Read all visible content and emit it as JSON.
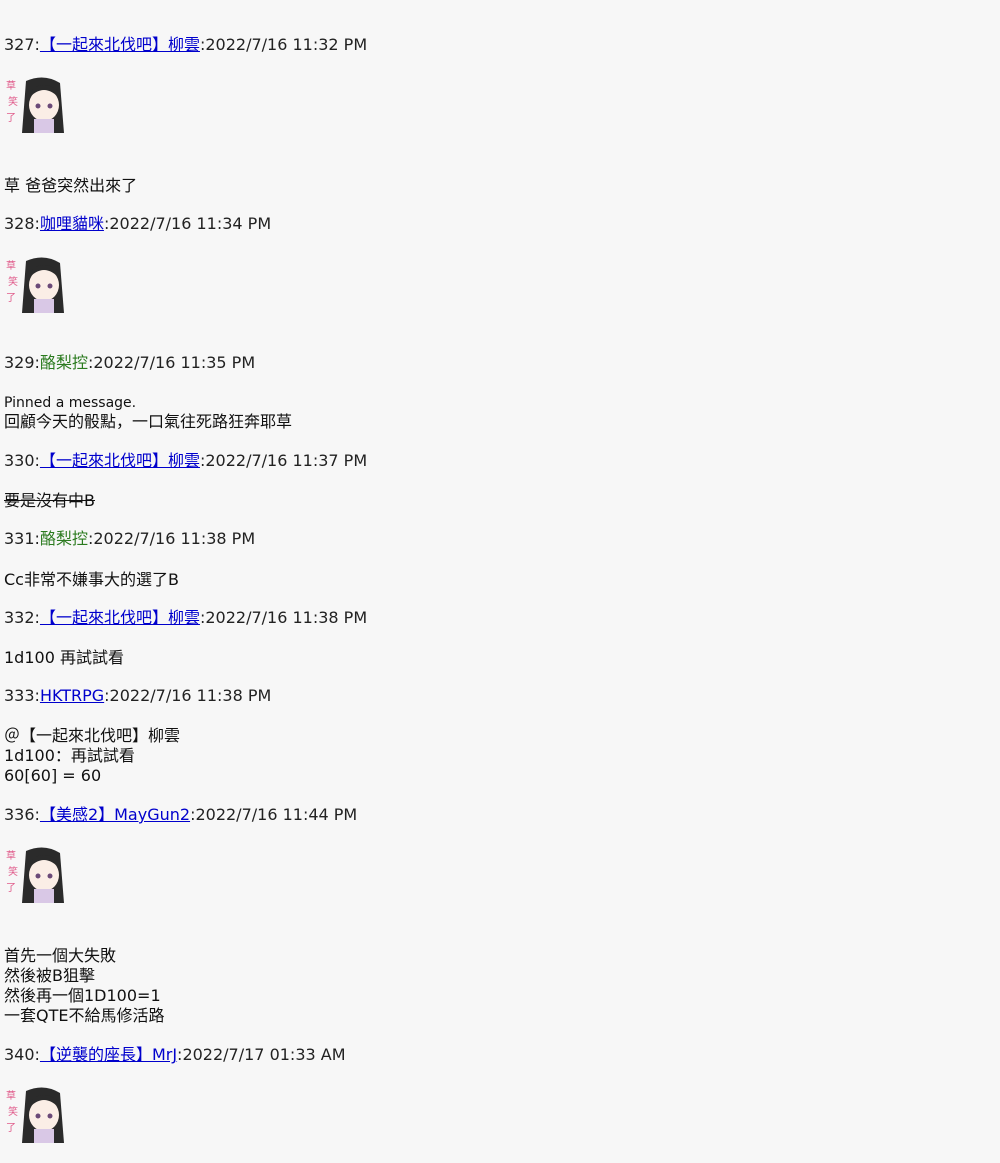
{
  "messages": [
    {
      "num": "327",
      "user": "【一起來北伐吧】柳雲",
      "ts": "2022/7/16 11:32 PM",
      "sticker": true,
      "sticker_text": "草 笑了",
      "lines": [
        "草 爸爸突然出來了"
      ]
    },
    {
      "num": "328",
      "user": "咖哩貓咪",
      "ts": "2022/7/16 11:34 PM",
      "sticker": true,
      "sticker_text": "草 笑了",
      "lines": []
    },
    {
      "num": "329",
      "user": "酪梨控",
      "ts": "2022/7/16 11:35 PM",
      "sticker": false,
      "pinned": "Pinned a message.",
      "lines": [
        "回顧今天的骰點，一口氣往死路狂奔耶草"
      ]
    },
    {
      "num": "330",
      "user": "【一起來北伐吧】柳雲",
      "ts": "2022/7/16 11:37 PM",
      "lines": [
        "要是沒有中B"
      ]
    },
    {
      "num": "331",
      "user": "酪梨控",
      "ts": "2022/7/16 11:38 PM",
      "lines": [
        "Cc非常不嫌事大的選了B"
      ]
    },
    {
      "num": "332",
      "user": "【一起來北伐吧】柳雲",
      "ts": "2022/7/16 11:38 PM",
      "lines": [
        "1d100 再試試看"
      ]
    },
    {
      "num": "333",
      "user": "HKTRPG",
      "ts": "2022/7/16 11:38 PM",
      "lines": [
        "＠【一起來北伐吧】柳雲",
        "1d100：再試試看",
        "60[60] = 60"
      ]
    },
    {
      "num": "336",
      "user": "【美感2】MayGun2",
      "ts": "2022/7/16 11:44 PM",
      "sticker": true,
      "sticker_text": "草 笑了",
      "lines": [
        "首先一個大失敗",
        "然後被B狙擊",
        "然後再一個1D100=1",
        "一套QTE不給馬修活路"
      ]
    },
    {
      "num": "340",
      "user": "【逆襲的座長】MrJ",
      "ts": "2022/7/17 01:33 AM",
      "sticker": true,
      "sticker_text": "草 笑了",
      "lines": []
    }
  ],
  "colors": {
    "link_blue": "#0000cc",
    "user_green": "#2a7a1e",
    "background": "#f7f7f7"
  }
}
